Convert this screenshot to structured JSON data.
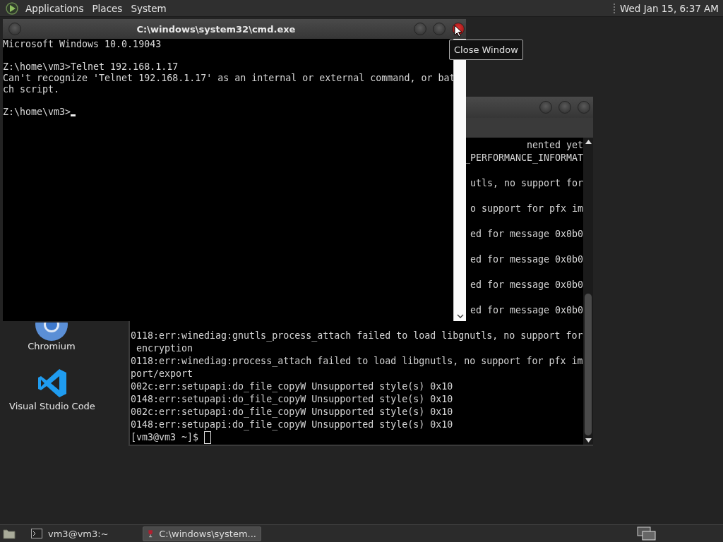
{
  "top_panel": {
    "menus": [
      "Applications",
      "Places",
      "System"
    ],
    "clock": "Wed Jan 15, 6:37 AM"
  },
  "desktop_icons": [
    {
      "kind": "chromium",
      "label": "Chromium"
    },
    {
      "kind": "vscode",
      "label": "Visual Studio Code"
    }
  ],
  "terminal_window": {
    "fragment_blocks": [
      [
        "nented yet",
        "_PERFORMANCE_INFORMAT"
      ],
      [
        "utls, no support for"
      ],
      [
        "o support for pfx im"
      ],
      [
        "ed for message 0x0b0"
      ],
      [
        "ed for message 0x0b0"
      ],
      [
        "ed for message 0x0b0"
      ],
      [
        "ed for message 0x0b0"
      ]
    ],
    "lines": [
      "0118:err:winediag:gnutls_process_attach failed to load libgnutls, no support for",
      " encryption",
      "0118:err:winediag:process_attach failed to load libgnutls, no support for pfx im",
      "port/export",
      "002c:err:setupapi:do_file_copyW Unsupported style(s) 0x10",
      "0148:err:setupapi:do_file_copyW Unsupported style(s) 0x10",
      "002c:err:setupapi:do_file_copyW Unsupported style(s) 0x10",
      "0148:err:setupapi:do_file_copyW Unsupported style(s) 0x10"
    ],
    "prompt": "[vm3@vm3 ~]$"
  },
  "cmd_window": {
    "title": "C:\\windows\\system32\\cmd.exe",
    "paragraphs": [
      [
        "Microsoft Windows 10.0.19043"
      ],
      [
        "Z:\\home\\vm3>Telnet 192.168.1.17",
        "Can't recognize 'Telnet 192.168.1.17' as an internal or external command, or bat",
        "ch script."
      ]
    ],
    "prompt": "Z:\\home\\vm3>"
  },
  "tooltip": "Close Window",
  "taskbar": {
    "tasks": [
      {
        "kind": "terminal",
        "label": "vm3@vm3:~",
        "selected": false
      },
      {
        "kind": "wine",
        "label": "C:\\windows\\system...",
        "selected": true
      }
    ]
  }
}
